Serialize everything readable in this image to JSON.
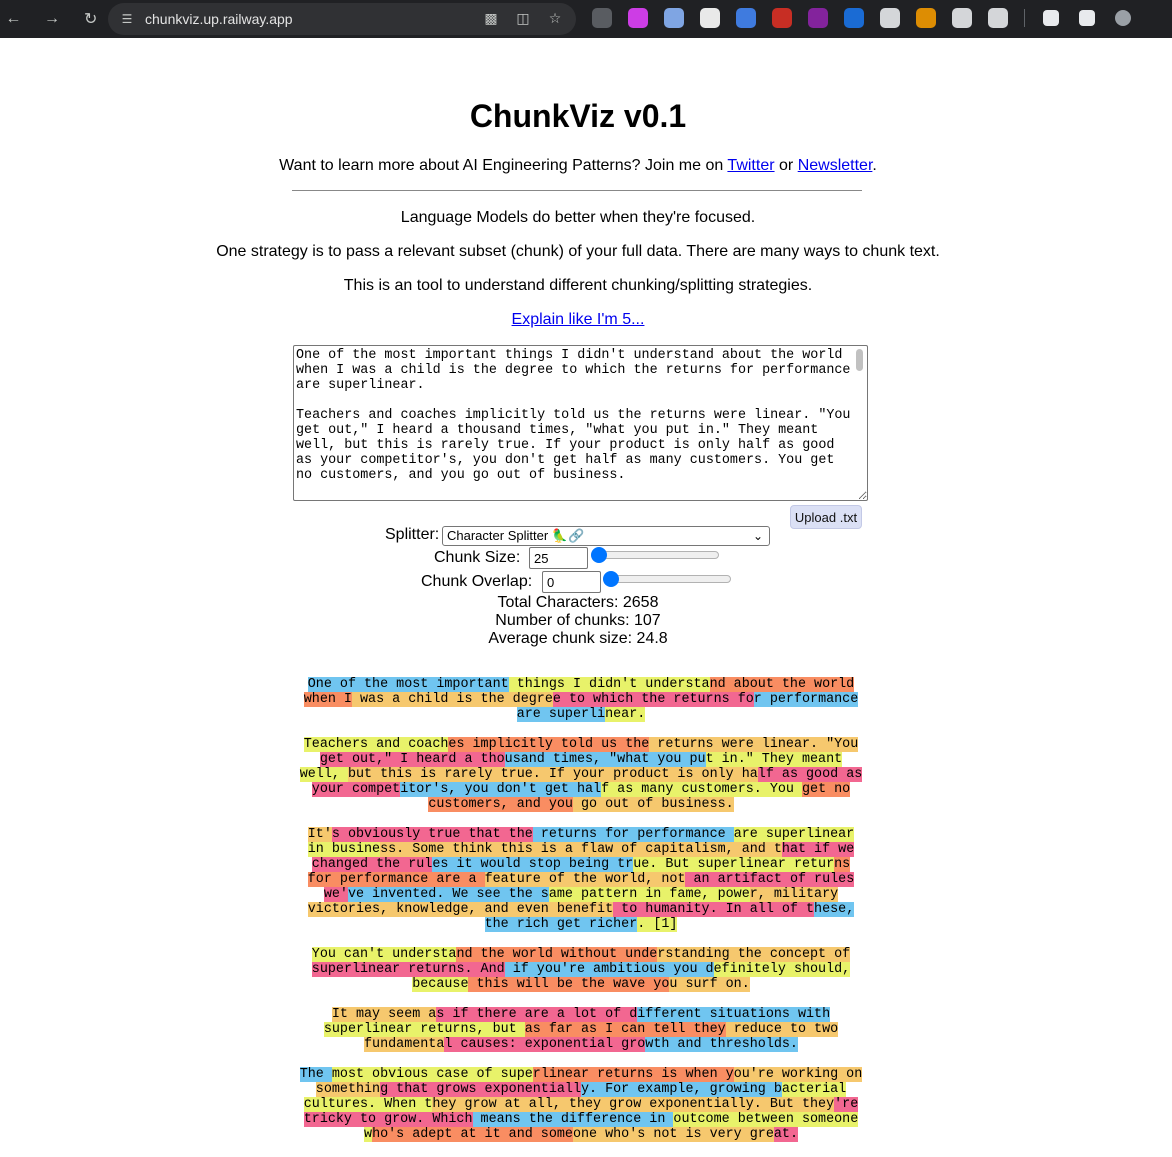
{
  "browser": {
    "url": "chunkviz.up.railway.app",
    "extension_colors": [
      "#5f6368",
      "#e040fb",
      "#8ab4f8",
      "#ffffff",
      "#4285f4",
      "#d93025",
      "#8e24aa",
      "#1a73e8",
      "#e8eaed",
      "#f29900",
      "#e8eaed",
      "#e8eaed"
    ]
  },
  "header": {
    "title": "ChunkViz v0.1",
    "intro_prefix": "Want to learn more about AI Engineering Patterns? Join me on",
    "twitter_link": "Twitter",
    "intro_or": "or",
    "newsletter_link": "Newsletter",
    "intro_suffix": "."
  },
  "description": {
    "line1": "Language Models do better when they're focused.",
    "line2": "One strategy is to pass a relevant subset (chunk) of your full data. There are many ways to chunk text.",
    "line3": "This is an tool to understand different chunking/splitting strategies.",
    "eli5_link": "Explain like I'm 5..."
  },
  "input_text": "One of the most important things I didn't understand about the world when I was a child is the degree to which the returns for performance are superlinear.\n\nTeachers and coaches implicitly told us the returns were linear. \"You get out,\" I heard a thousand times, \"what you put in.\" They meant well, but this is rarely true. If your product is only half as good as your competitor's, you don't get half as many customers. You get no customers, and you go out of business.",
  "controls": {
    "upload_label": "Upload .txt",
    "splitter_label": "Splitter:",
    "splitter_value": "Character Splitter 🦜🔗",
    "chunk_size_label": "Chunk Size:",
    "chunk_size_value": "25",
    "chunk_size_fraction": 0.0,
    "chunk_overlap_label": "Chunk Overlap:",
    "chunk_overlap_value": "0",
    "chunk_overlap_fraction": 0.0
  },
  "stats": {
    "total_characters": "Total Characters: 2658",
    "number_of_chunks": "Number of chunks: 107",
    "average_chunk_size": "Average chunk size: 24.8"
  },
  "chunk_colors": [
    "#70c5f0",
    "#e8f26a",
    "#f98d62",
    "#f6c86e",
    "#f26791"
  ],
  "chunked_paragraphs": [
    [
      {
        "t": "One of the most important",
        "c": 0
      },
      {
        "t": " things I didn't understa",
        "c": 1
      },
      {
        "t": "nd about the world ",
        "c": 2
      },
      {
        "t": "when I",
        "c": 2
      },
      {
        "t": " was a child is the degre",
        "c": 3
      },
      {
        "t": "e to which the returns fo",
        "c": 4
      },
      {
        "t": "r performance ",
        "c": 0
      },
      {
        "t": "are superli",
        "c": 0
      },
      {
        "t": "near.",
        "c": 1
      }
    ],
    [
      {
        "t": "Teachers and coach",
        "c": 1
      },
      {
        "t": "es implicitly told us the",
        "c": 2
      },
      {
        "t": " returns were linear. \"You ",
        "c": 3
      },
      {
        "t": "get out,\" I heard a tho",
        "c": 4
      },
      {
        "t": "usand times, \"what you pu",
        "c": 0
      },
      {
        "t": "t in.\" They meant well, ",
        "c": 1
      },
      {
        "t": "but this is rarely true. I",
        "c": 3
      },
      {
        "t": "f your product is only ha",
        "c": 3
      },
      {
        "t": "lf as good as your ",
        "c": 4
      },
      {
        "t": "compet",
        "c": 4
      },
      {
        "t": "itor's, you don't get hal",
        "c": 0
      },
      {
        "t": "f as many customers. You ",
        "c": 1
      },
      {
        "t": "get no ",
        "c": 2
      },
      {
        "t": "customers, and you",
        "c": 2
      },
      {
        "t": " go out of business.",
        "c": 3
      }
    ],
    [
      {
        "t": "It'",
        "c": 3
      },
      {
        "t": "s obviously true that the",
        "c": 4
      },
      {
        "t": " returns for performance ",
        "c": 0
      },
      {
        "t": "are superlinear in ",
        "c": 1
      },
      {
        "t": "busine",
        "c": 1
      },
      {
        "t": "ss. Some think this is a ",
        "c": 3
      },
      {
        "t": "flaw of capitalism, and t",
        "c": 3
      },
      {
        "t": "hat if we ",
        "c": 4
      },
      {
        "t": "changed the rul",
        "c": 4
      },
      {
        "t": "es it would stop being tr",
        "c": 0
      },
      {
        "t": "ue. But superlinear retur",
        "c": 1
      },
      {
        "t": "ns for ",
        "c": 2
      },
      {
        "t": "performance are a ",
        "c": 2
      },
      {
        "t": "feature of the world, not",
        "c": 3
      },
      {
        "t": " an artifact of rules we'",
        "c": 4
      },
      {
        "t": "ve ",
        "c": 0
      },
      {
        "t": "invented. We see the s",
        "c": 0
      },
      {
        "t": "ame pattern in fame, powe",
        "c": 1
      },
      {
        "t": "r, military victories, ",
        "c": 3
      },
      {
        "t": "kn",
        "c": 3
      },
      {
        "t": "owledge, and even benefit",
        "c": 3
      },
      {
        "t": " to humanity. In all of t",
        "c": 4
      },
      {
        "t": "hese, the rich get ",
        "c": 0
      },
      {
        "t": "richer",
        "c": 0
      },
      {
        "t": ". [1]",
        "c": 1
      }
    ],
    [
      {
        "t": "You can't understa",
        "c": 1
      },
      {
        "t": "nd the world without unde",
        "c": 2
      },
      {
        "t": "rstanding the concept of ",
        "c": 3
      },
      {
        "t": "superlinear returns. And",
        "c": 4
      },
      {
        "t": " if you're ambitious you d",
        "c": 0
      },
      {
        "t": "efinitely should, ",
        "c": 1
      },
      {
        "t": "because",
        "c": 1
      },
      {
        "t": " this will be the wave yo",
        "c": 2
      },
      {
        "t": "u surf on.",
        "c": 3
      }
    ],
    [
      {
        "t": "It may seem a",
        "c": 3
      },
      {
        "t": "s if there are a lot of d",
        "c": 4
      },
      {
        "t": "ifferent situations with ",
        "c": 0
      },
      {
        "t": "superlinear returns, but ",
        "c": 1
      },
      {
        "t": "as far as I can tell they",
        "c": 2
      },
      {
        "t": " reduce to two ",
        "c": 3
      },
      {
        "t": "fundamenta",
        "c": 3
      },
      {
        "t": "l causes: exponential gro",
        "c": 4
      },
      {
        "t": "wth and thresholds.",
        "c": 0
      }
    ],
    [
      {
        "t": "The ",
        "c": 0
      },
      {
        "t": "most obvious case of supe",
        "c": 1
      },
      {
        "t": "rlinear returns is when y",
        "c": 2
      },
      {
        "t": "ou're working on ",
        "c": 3
      },
      {
        "t": "somethin",
        "c": 3
      },
      {
        "t": "g that grows exponentiall",
        "c": 4
      },
      {
        "t": "y. For example, growing b",
        "c": 0
      },
      {
        "t": "acterial ",
        "c": 1
      },
      {
        "t": "cultures. When t",
        "c": 1
      },
      {
        "t": "hey grow at all, they gro",
        "c": 3
      },
      {
        "t": "w exponentially. But they",
        "c": 3
      },
      {
        "t": "'re ",
        "c": 4
      },
      {
        "t": "tricky to grow. Which",
        "c": 4
      },
      {
        "t": " means the difference in ",
        "c": 0
      },
      {
        "t": "outcome between someone ",
        "c": 1
      },
      {
        "t": "w",
        "c": 1
      },
      {
        "t": "ho's adept at it and some",
        "c": 2
      },
      {
        "t": "one who's not is very gre",
        "c": 3
      },
      {
        "t": "at.",
        "c": 4
      }
    ]
  ]
}
